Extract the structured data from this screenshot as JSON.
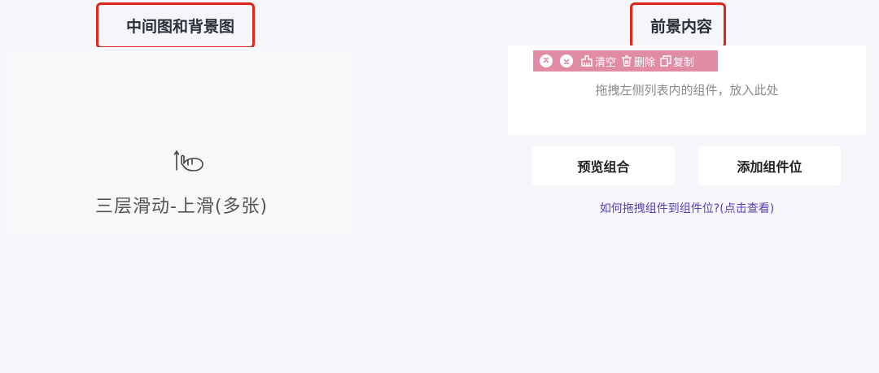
{
  "left_panel": {
    "heading": "中间图和背景图",
    "gesture_icon": "swipe-up-hand-icon",
    "caption": "三层滑动-上滑(多张)"
  },
  "right_panel": {
    "heading": "前景内容",
    "toolbar": {
      "collapse_icon": "chevron-up-circle-icon",
      "expand_icon": "chevron-down-circle-icon",
      "clear_label": "清空",
      "delete_label": "删除",
      "copy_label": "复制",
      "color": "#e08ca5"
    },
    "drop_hint": "拖拽左侧列表内的组件，放入此处",
    "preview_button": "预览组合",
    "add_slot_button": "添加组件位",
    "help_link": "如何拖拽组件到组件位?(点击查看)"
  },
  "colors": {
    "highlight_border": "#e1251b",
    "background": "#f5f6fa",
    "link": "#5b3db4"
  }
}
